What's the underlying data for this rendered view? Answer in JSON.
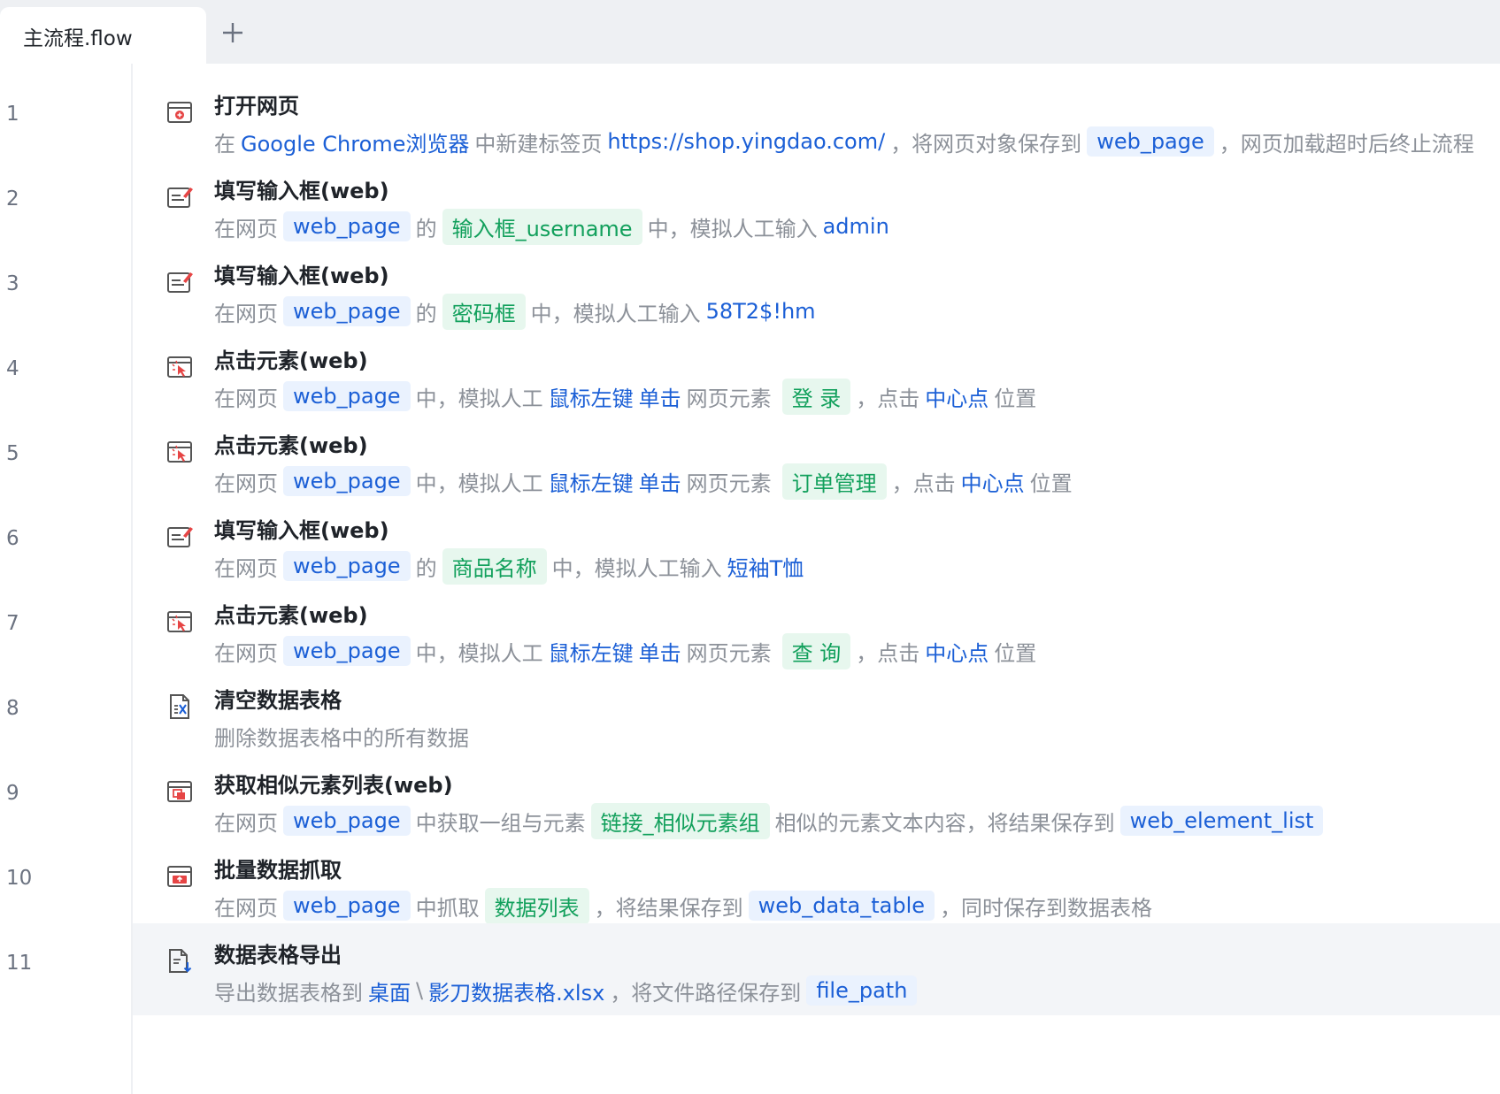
{
  "tabs": {
    "active_label": "主流程.flow"
  },
  "line_numbers": [
    "1",
    "2",
    "3",
    "4",
    "5",
    "6",
    "7",
    "8",
    "9",
    "10",
    "11"
  ],
  "steps": [
    {
      "title": "打开网页",
      "p": [
        "在",
        "Google Chrome浏览器",
        "中新建标签页",
        "https://shop.yingdao.com/",
        "，将网页对象保存到",
        "web_page",
        "，网页加载超时后终止流程"
      ]
    },
    {
      "title": "填写输入框(web)",
      "p": [
        "在网页",
        "web_page",
        "的",
        "输入框_username",
        "中，模拟人工输入",
        "admin"
      ]
    },
    {
      "title": "填写输入框(web)",
      "p": [
        "在网页",
        "web_page",
        "的",
        "密码框",
        "中，模拟人工输入",
        "58T2$!hm"
      ]
    },
    {
      "title": "点击元素(web)",
      "p": [
        "在网页",
        "web_page",
        "中，模拟人工",
        "鼠标左键",
        "单击",
        "网页元素",
        "登 录",
        "，点击",
        "中心点",
        "位置"
      ]
    },
    {
      "title": "点击元素(web)",
      "p": [
        "在网页",
        "web_page",
        "中，模拟人工",
        "鼠标左键",
        "单击",
        "网页元素",
        "订单管理",
        "，点击",
        "中心点",
        "位置"
      ]
    },
    {
      "title": "填写输入框(web)",
      "p": [
        "在网页",
        "web_page",
        "的",
        "商品名称",
        "中，模拟人工输入",
        "短袖T恤"
      ]
    },
    {
      "title": "点击元素(web)",
      "p": [
        "在网页",
        "web_page",
        "中，模拟人工",
        "鼠标左键",
        "单击",
        "网页元素",
        "查 询",
        "，点击",
        "中心点",
        "位置"
      ]
    },
    {
      "title": "清空数据表格",
      "p": [
        "删除数据表格中的所有数据"
      ]
    },
    {
      "title": "获取相似元素列表(web)",
      "p": [
        "在网页",
        "web_page",
        "中获取一组与元素",
        "链接_相似元素组",
        "相似的元素文本内容，将结果保存到",
        "web_element_list"
      ]
    },
    {
      "title": "批量数据抓取",
      "p": [
        "在网页",
        "web_page",
        "中抓取",
        "数据列表",
        "，将结果保存到",
        "web_data_table",
        "，同时保存到数据表格"
      ]
    },
    {
      "title": "数据表格导出",
      "p": [
        "导出数据表格到",
        "桌面",
        "\\",
        "影刀数据表格.xlsx",
        "，将文件路径保存到",
        "file_path"
      ]
    }
  ],
  "icons": [
    "open-webpage-icon",
    "fill-input-icon",
    "fill-input-icon",
    "click-element-icon",
    "click-element-icon",
    "fill-input-icon",
    "click-element-icon",
    "clear-table-icon",
    "similar-list-icon",
    "batch-scrape-icon",
    "export-table-icon"
  ],
  "colors": {
    "link_blue": "#1b5fd6",
    "element_green": "#12a05c",
    "muted": "#8c9199",
    "title": "#1f2329"
  }
}
